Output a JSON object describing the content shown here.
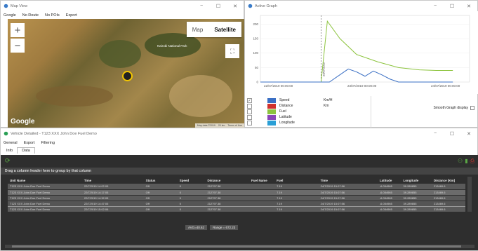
{
  "map_window": {
    "title": "Map View",
    "menu": [
      "Google",
      "No Route",
      "No POIs",
      "Export"
    ],
    "map_type": {
      "map": "Map",
      "satellite": "Satellite",
      "selected": "Satellite"
    },
    "zoom_in": "+",
    "zoom_out": "−",
    "google_logo": "Google",
    "footer": [
      "Map data ©2019",
      "20 km",
      "Terms of Use"
    ],
    "place_label": "Nairobi National Park"
  },
  "graph_window": {
    "title": "Active Graph",
    "smooth_label": "Smooth Graph display",
    "legend": [
      {
        "checked": true,
        "name": "Speed",
        "unit": "Km/H",
        "color": "#3a6fc4"
      },
      {
        "checked": false,
        "name": "Distance",
        "unit": "Km",
        "color": "#d0312d"
      },
      {
        "checked": false,
        "name": "Fuel",
        "unit": "",
        "color": "#8dc43f"
      },
      {
        "checked": false,
        "name": "Latitude",
        "unit": "",
        "color": "#8a46b8"
      },
      {
        "checked": false,
        "name": "Longitude",
        "unit": "",
        "color": "#2a9fd6"
      }
    ]
  },
  "chart_data": {
    "type": "line",
    "x_ticks": [
      "22/07/2019 00:00:00",
      "23/07/2019 00:00:00",
      "24/07/2019 00:00:00"
    ],
    "y_ticks": [
      0,
      50,
      100,
      150,
      200
    ],
    "ylim": [
      0,
      230
    ],
    "cursor_label": "23/07/2019",
    "series": [
      {
        "name": "Fuel",
        "color": "#8dc43f",
        "points": [
          [
            0.0,
            0
          ],
          [
            0.29,
            0
          ],
          [
            0.32,
            210
          ],
          [
            0.38,
            150
          ],
          [
            0.46,
            95
          ],
          [
            0.56,
            70
          ],
          [
            0.66,
            50
          ],
          [
            0.76,
            42
          ],
          [
            0.84,
            40
          ],
          [
            0.92,
            40
          ]
        ]
      },
      {
        "name": "Speed",
        "color": "#3a6fc4",
        "points": [
          [
            0.0,
            0
          ],
          [
            0.33,
            0
          ],
          [
            0.38,
            25
          ],
          [
            0.42,
            45
          ],
          [
            0.46,
            35
          ],
          [
            0.5,
            20
          ],
          [
            0.54,
            38
          ],
          [
            0.58,
            25
          ],
          [
            0.62,
            10
          ],
          [
            0.66,
            0
          ],
          [
            0.92,
            0
          ]
        ]
      }
    ]
  },
  "vehicle_window": {
    "title": "Vehicle Detailed - T123 XXX John Doe Fuel Demo",
    "menu": [
      "General",
      "Export",
      "Filtering"
    ],
    "tabs": [
      "Info",
      "Data"
    ],
    "active_tab": "Data",
    "group_hint": "Drag a column header here to group by that column",
    "columns": [
      "Unit Name",
      "Time",
      "Status",
      "Speed",
      "Distance",
      "Fuel Name",
      "Fuel",
      "Time",
      "Latitude",
      "Longitude",
      "Distance [Km]"
    ],
    "rows": [
      [
        "T123 XXX John Doe Fuel Demo",
        "22/7/2019 14:02:05",
        "Off",
        "0",
        "212797.38",
        "",
        "7.19",
        "24/7/2019 15:07:56",
        "-6.054965",
        "39.289855",
        "213469.6"
      ],
      [
        "T123 XXX John Doe Fuel Demo",
        "22/7/2019 14:17:05",
        "Off",
        "0",
        "212797.38",
        "",
        "7.19",
        "24/7/2019 15:07:56",
        "-6.054965",
        "39.289855",
        "213469.6"
      ],
      [
        "T123 XXX John Doe Fuel Demo",
        "22/7/2019 14:32:05",
        "Off",
        "0",
        "212797.38",
        "",
        "7.19",
        "24/7/2019 15:07:56",
        "-6.054965",
        "39.289855",
        "213469.6"
      ],
      [
        "T123 XXX John Doe Fuel Demo",
        "22/7/2019 14:47:05",
        "Off",
        "0",
        "212797.38",
        "",
        "7.19",
        "24/7/2019 15:07:56",
        "-6.054965",
        "39.289855",
        "213469.6"
      ],
      [
        "T123 XXX John Doe Fuel Demo",
        "22/7/2019 15:02:06",
        "Off",
        "0",
        "212797.38",
        "",
        "7.19",
        "24/7/2019 15:07:56",
        "-6.054965",
        "39.289855",
        "213469.6"
      ]
    ],
    "selected_row": 3,
    "summary": {
      "avg": "AVG=40.62",
      "range": "Range = 672.23"
    }
  },
  "colors": {
    "dark_bg": "#2e2e2e",
    "row": "#5a5a5a",
    "green_icon": "#5aa845",
    "red_icon": "#d0312d"
  }
}
